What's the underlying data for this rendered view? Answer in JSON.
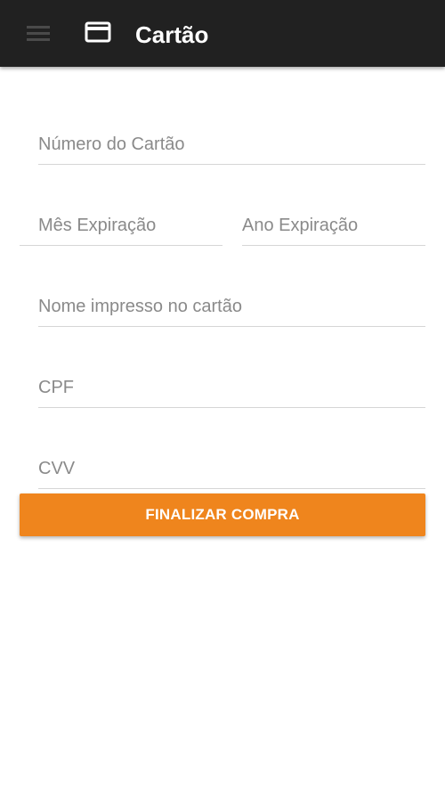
{
  "appbar": {
    "title": "Cartão",
    "menu_icon": "hamburger-menu-icon",
    "title_icon": "credit-card-icon",
    "background": "#212121"
  },
  "form": {
    "card_number": {
      "placeholder": "Número do Cartão",
      "value": ""
    },
    "exp_month": {
      "placeholder": "Mês Expiração",
      "value": ""
    },
    "exp_year": {
      "placeholder": "Ano Expiração",
      "value": ""
    },
    "name_on_card": {
      "placeholder": "Nome impresso no cartão",
      "value": ""
    },
    "cpf": {
      "placeholder": "CPF",
      "value": ""
    },
    "cvv": {
      "placeholder": "CVV",
      "value": ""
    }
  },
  "actions": {
    "submit_label": "FINALIZAR COMPRA",
    "submit_color": "#ef851d"
  }
}
